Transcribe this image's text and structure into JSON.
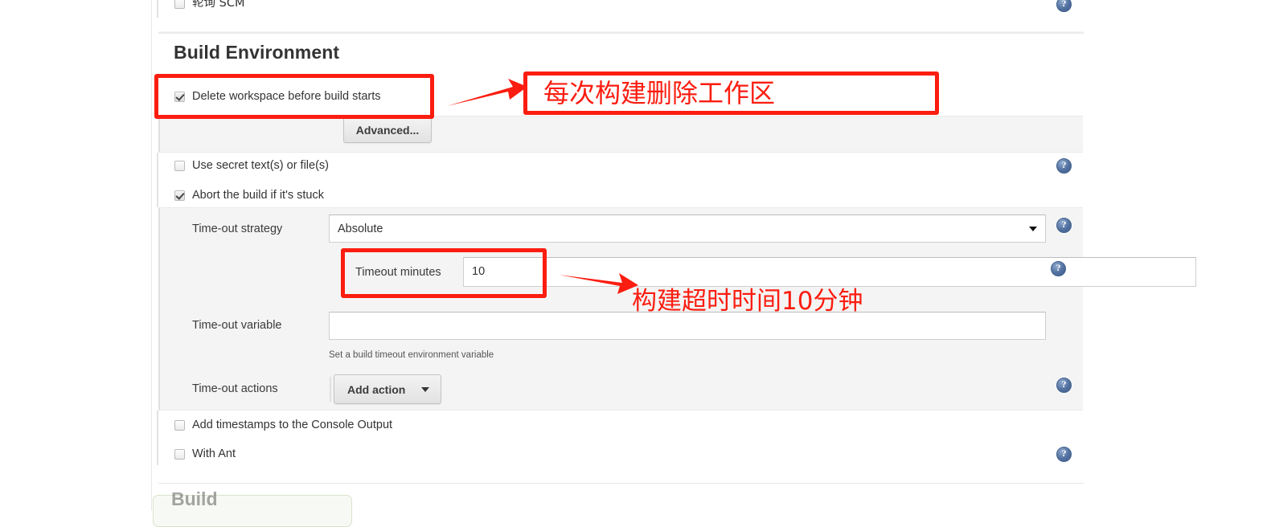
{
  "section": {
    "title": "Build Environment"
  },
  "top_row": {
    "label": "轮询 SCM",
    "checked": false
  },
  "options": [
    {
      "label": "Delete workspace before build starts",
      "checked": true
    },
    {
      "label": "Use secret text(s) or file(s)",
      "checked": false
    },
    {
      "label": "Abort the build if it's stuck",
      "checked": true
    },
    {
      "label": "Add timestamps to the Console Output",
      "checked": false
    },
    {
      "label": "With Ant",
      "checked": false
    }
  ],
  "advanced_button": {
    "label": "Advanced..."
  },
  "timeout_panel": {
    "strategy_label": "Time-out strategy",
    "strategy_value": "Absolute",
    "minutes_label": "Timeout minutes",
    "minutes_value": "10",
    "variable_label": "Time-out variable",
    "variable_value": "",
    "variable_placeholder": "",
    "variable_help": "Set a build timeout environment variable",
    "actions_label": "Time-out actions",
    "add_action_label": "Add action"
  },
  "help_icon": {
    "glyph": "?",
    "name": "help-icon"
  },
  "annotations": [
    {
      "id": "delete-workspace-note",
      "text": "每次构建删除工作区"
    },
    {
      "id": "timeout-note",
      "text": "构建超时时间10分钟"
    }
  ],
  "build_section": {
    "title": "Build"
  },
  "colors": {
    "annotation_red": "#fb1d10",
    "help_blue": "#52709f",
    "panel_gray": "#f4f4f4",
    "page_white": "#ffffff",
    "text_dark": "#333333"
  }
}
